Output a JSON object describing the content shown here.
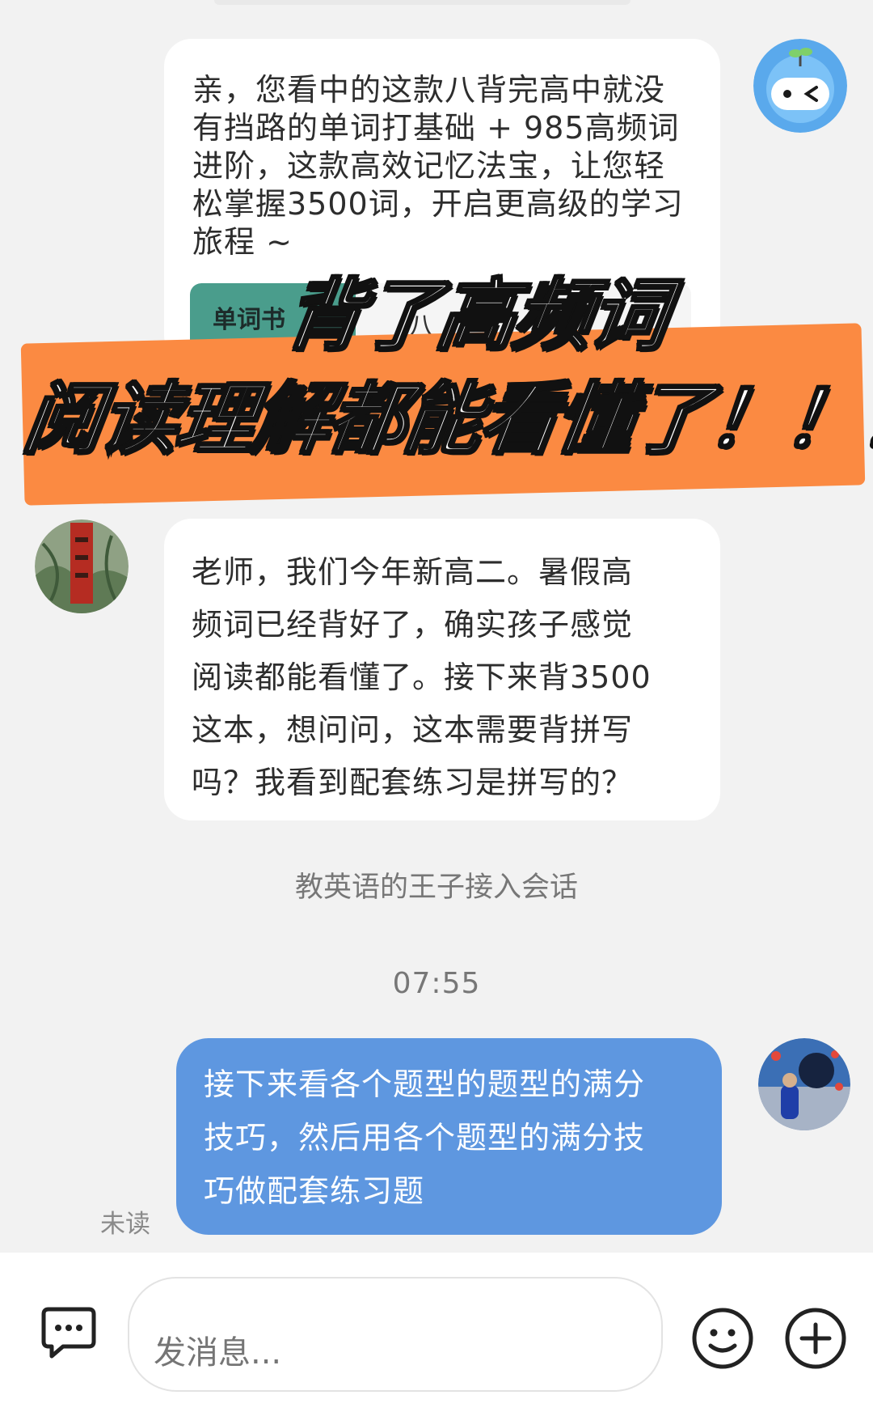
{
  "messages": [
    {
      "sender": "agent",
      "text": "亲，您看中的这款八背完高中就没\n有挡路的单词打基础 + 985高频词\n进阶，这款高效记忆法宝，让您轻\n松掌握3500词，开启更高级的学习\n旅程 ~"
    },
    {
      "sender": "customer",
      "text": "老师，我们今年新高二。暑假高\n频词已经背好了，确实孩子感觉\n阅读都能看懂了。接下来背3500\n这本，想问问，这本需要背拼写\n吗？我看到配套练习是拼写的？"
    },
    {
      "sender": "self",
      "text": "接下来看各个题型的题型的满分\n技巧，然后用各个题型的满分技\n巧做配套练习题",
      "status": "未读"
    }
  ],
  "product_card": {
    "thumb_label": "单词书",
    "title": "八"
  },
  "overlay": {
    "line1": "背了高频词",
    "line2": "阅读理解都能看懂了！！！",
    "band_color": "#fb8a42"
  },
  "system_note": "教英语的王子接入会话",
  "timestamp": "07:55",
  "composer": {
    "placeholder": "发消息..."
  },
  "icons": {
    "left": "chat-bubble-icon",
    "emoji": "smiley-icon",
    "plus": "plus-circle-icon"
  },
  "colors": {
    "background": "#f2f2f2",
    "self_bubble": "#5e97e0",
    "other_bubble": "#ffffff"
  }
}
